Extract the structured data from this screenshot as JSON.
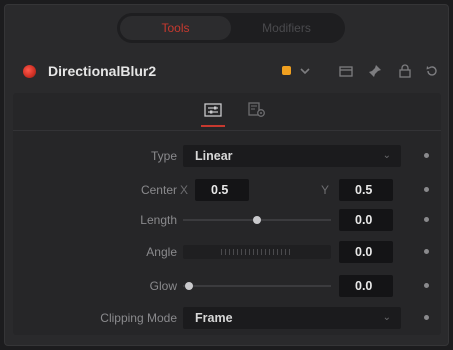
{
  "tabs": [
    {
      "label": "Tools",
      "active": true
    },
    {
      "label": "Modifiers",
      "active": false
    }
  ],
  "header": {
    "title": "DirectionalBlur2",
    "color_chip": "#f0a020"
  },
  "controls": {
    "type": {
      "label": "Type",
      "value": "Linear"
    },
    "center": {
      "label": "Center",
      "x_axis": "X",
      "x_value": "0.5",
      "y_axis": "Y",
      "y_value": "0.5"
    },
    "length": {
      "label": "Length",
      "value": "0.0",
      "slider_fraction": 0.5
    },
    "angle": {
      "label": "Angle",
      "value": "0.0"
    },
    "glow": {
      "label": "Glow",
      "value": "0.0",
      "slider_fraction": 0.0
    },
    "clipping_mode": {
      "label": "Clipping Mode",
      "value": "Frame"
    }
  },
  "colors": {
    "accent_red": "#c7392f",
    "panel": "#2a2a2c"
  }
}
